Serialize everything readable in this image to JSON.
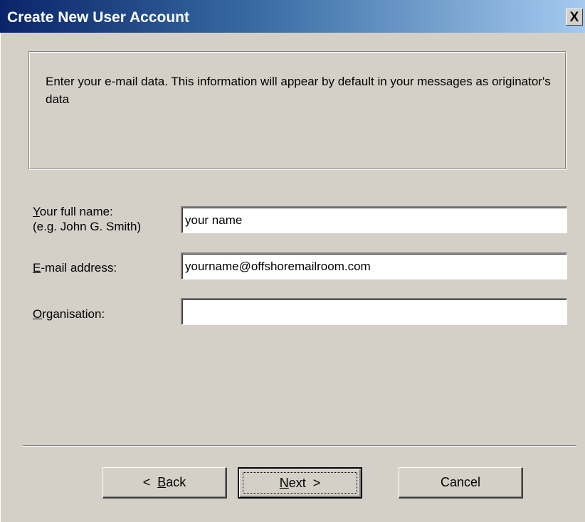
{
  "window": {
    "title": "Create New User Account",
    "close_glyph": "X"
  },
  "info": {
    "text": "Enter your e-mail data. This information will appear by default in your messages as originator's data"
  },
  "form": {
    "full_name": {
      "label_accel": "Y",
      "label_rest": "our full name:",
      "hint": "(e.g. John G. Smith)",
      "value": "your name"
    },
    "email": {
      "label_accel": "E",
      "label_rest": "-mail address:",
      "value": "yourname@offshoremailroom.com"
    },
    "organisation": {
      "label_accel": "O",
      "label_rest": "rganisation:",
      "value": ""
    }
  },
  "buttons": {
    "back": {
      "prefix": "<  ",
      "accel": "B",
      "rest": "ack"
    },
    "next": {
      "accel": "N",
      "rest": "ext",
      "suffix": "  >"
    },
    "cancel": {
      "label": "Cancel"
    }
  },
  "colors": {
    "face": "#d4d0c8",
    "title_start": "#0a246a",
    "title_end": "#a6caf0"
  }
}
